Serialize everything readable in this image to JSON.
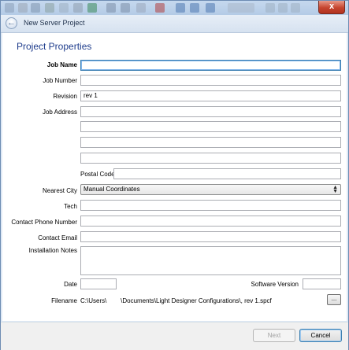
{
  "window": {
    "header_title": "New Server Project",
    "close_label": "x"
  },
  "section_title": "Project Properties",
  "form": {
    "job_name": {
      "label": "Job Name",
      "value": ""
    },
    "job_number": {
      "label": "Job Number",
      "value": ""
    },
    "revision": {
      "label": "Revision",
      "value": "rev 1"
    },
    "job_address": {
      "label": "Job Address",
      "lines": [
        "",
        "",
        "",
        ""
      ]
    },
    "postal_code": {
      "label": "Postal Code",
      "value": ""
    },
    "nearest_city": {
      "label": "Nearest City",
      "selected": "Manual Coordinates"
    },
    "tech": {
      "label": "Tech",
      "value": ""
    },
    "contact_phone": {
      "label": "Contact Phone Number",
      "value": ""
    },
    "contact_email": {
      "label": "Contact Email",
      "value": ""
    },
    "installation_notes": {
      "label": "Installation Notes",
      "value": ""
    },
    "date": {
      "label": "Date",
      "value": ""
    },
    "software_version": {
      "label": "Software Version",
      "value": ""
    },
    "filename": {
      "label": "Filename",
      "value": "C:\\Users\\        \\Documents\\Light Designer Configurations\\, rev 1.spcf",
      "browse_label": "..."
    }
  },
  "buttons": {
    "next": "Next",
    "cancel": "Cancel"
  },
  "colors": {
    "accent": "#1e3c8c",
    "focus": "#3c7fb1",
    "close": "#c6452f"
  },
  "icons": [
    "toolbar-icon",
    "back-arrow-icon",
    "close-icon",
    "dropdown-arrows-icon"
  ]
}
